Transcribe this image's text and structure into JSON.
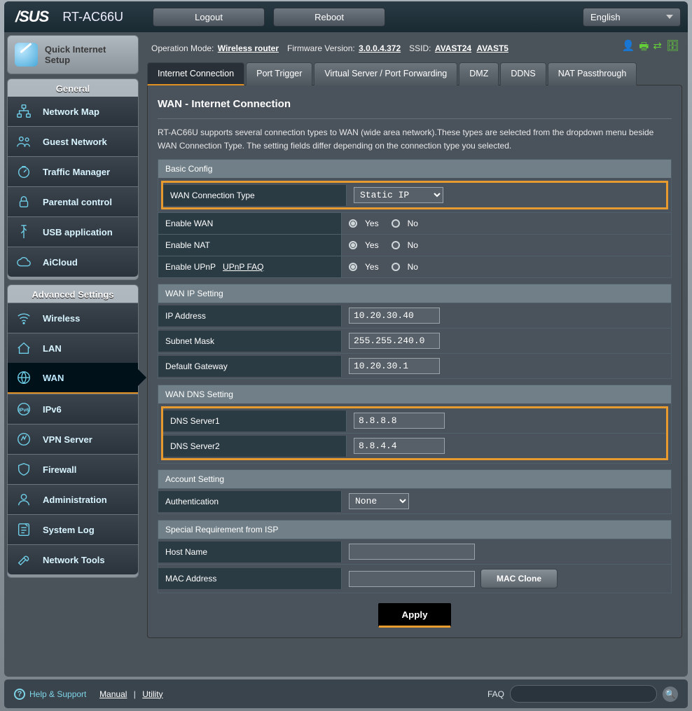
{
  "brand": "/SUS",
  "model": "RT-AC66U",
  "buttons": {
    "logout": "Logout",
    "reboot": "Reboot",
    "language": "English"
  },
  "info": {
    "opmode_label": "Operation Mode:",
    "opmode": "Wireless router",
    "fw_label": "Firmware Version:",
    "fw": "3.0.0.4.372",
    "ssid_label": "SSID:",
    "ssid1": "AVAST24",
    "ssid2": "AVAST5"
  },
  "sidebar": {
    "quick": "Quick Internet Setup",
    "general_title": "General",
    "general": [
      {
        "label": "Network Map",
        "name": "network-map"
      },
      {
        "label": "Guest Network",
        "name": "guest-network"
      },
      {
        "label": "Traffic Manager",
        "name": "traffic-manager"
      },
      {
        "label": "Parental control",
        "name": "parental-control"
      },
      {
        "label": "USB application",
        "name": "usb-application"
      },
      {
        "label": "AiCloud",
        "name": "aicloud"
      }
    ],
    "adv_title": "Advanced Settings",
    "advanced": [
      {
        "label": "Wireless",
        "name": "wireless"
      },
      {
        "label": "LAN",
        "name": "lan"
      },
      {
        "label": "WAN",
        "name": "wan",
        "active": true
      },
      {
        "label": "IPv6",
        "name": "ipv6"
      },
      {
        "label": "VPN Server",
        "name": "vpn-server"
      },
      {
        "label": "Firewall",
        "name": "firewall"
      },
      {
        "label": "Administration",
        "name": "administration"
      },
      {
        "label": "System Log",
        "name": "system-log"
      },
      {
        "label": "Network Tools",
        "name": "network-tools"
      }
    ]
  },
  "tabs": [
    {
      "label": "Internet Connection",
      "active": true
    },
    {
      "label": "Port Trigger"
    },
    {
      "label": "Virtual Server / Port Forwarding"
    },
    {
      "label": "DMZ"
    },
    {
      "label": "DDNS"
    },
    {
      "label": "NAT Passthrough"
    }
  ],
  "page": {
    "title": "WAN - Internet Connection",
    "desc": "RT-AC66U supports several connection types to WAN (wide area network).These types are selected from the dropdown menu beside WAN Connection Type. The setting fields differ depending on the connection type you selected.",
    "basic": {
      "head": "Basic Config",
      "conn_type_label": "WAN Connection Type",
      "conn_type": "Static IP",
      "enable_wan": "Enable WAN",
      "enable_nat": "Enable NAT",
      "enable_upnp": "Enable UPnP",
      "upnp_faq": "UPnP  FAQ",
      "yes": "Yes",
      "no": "No"
    },
    "wanip": {
      "head": "WAN IP Setting",
      "ip_label": "IP Address",
      "ip": "10.20.30.40",
      "subnet_label": "Subnet Mask",
      "subnet": "255.255.240.0",
      "gw_label": "Default Gateway",
      "gw": "10.20.30.1"
    },
    "dns": {
      "head": "WAN DNS Setting",
      "dns1_label": "DNS Server1",
      "dns1": "8.8.8.8",
      "dns2_label": "DNS Server2",
      "dns2": "8.8.4.4"
    },
    "account": {
      "head": "Account Setting",
      "auth_label": "Authentication",
      "auth": "None"
    },
    "isp": {
      "head": "Special Requirement from ISP",
      "host_label": "Host Name",
      "host": "",
      "mac_label": "MAC Address",
      "mac": "",
      "mac_clone": "MAC Clone"
    },
    "apply": "Apply"
  },
  "footer": {
    "help": "Help & Support",
    "manual": "Manual",
    "utility": "Utility",
    "faq": "FAQ"
  }
}
